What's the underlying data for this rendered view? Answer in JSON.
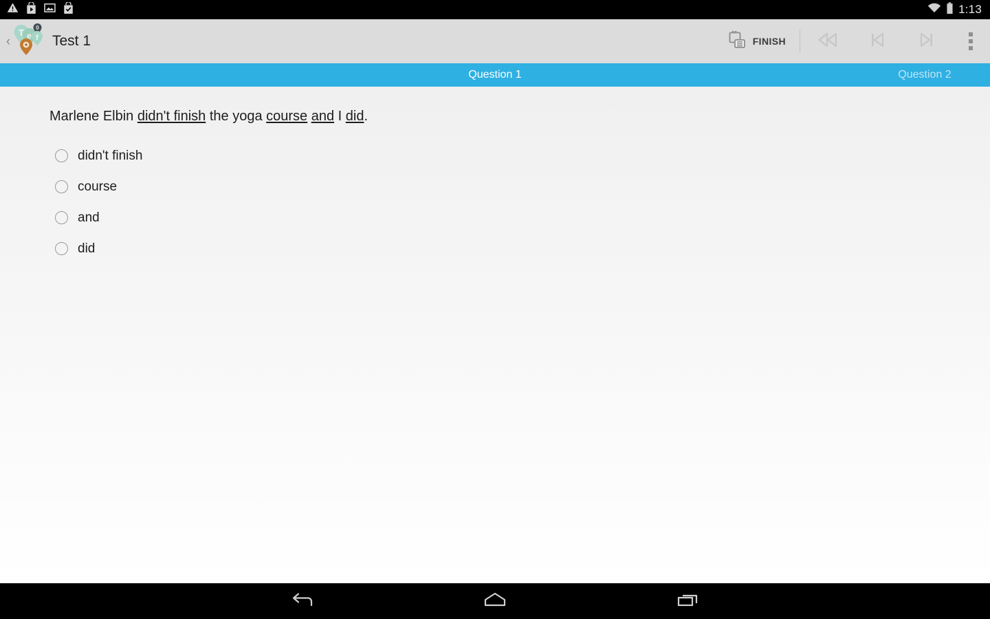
{
  "status_bar": {
    "time": "1:13",
    "left_icons": [
      "warning-triangle-icon",
      "play-store-bag-icon",
      "image-icon",
      "check-bag-icon"
    ],
    "right_icons": [
      "wifi-icon",
      "battery-icon"
    ],
    "background_color": "#000000"
  },
  "toolbar": {
    "back_chevron": "‹",
    "app_title": "Test 1",
    "logo_name": "teofo-pins-logo",
    "logo_letters": [
      "T",
      "e",
      "0",
      "f",
      "o"
    ],
    "logo_colors": {
      "teal": "#9fd2c8",
      "teal_light": "#a8d8ca",
      "orange": "#c97a2c",
      "dark": "#3f4a52"
    },
    "finish_label": "FINISH",
    "finish_icon": "clipboard-list-icon",
    "rewind_icon": "rewind-icon",
    "skip_previous_icon": "skip-previous-icon",
    "skip_next_icon": "skip-next-icon",
    "overflow_icon": "overflow-menu-icon",
    "background_color": "#dcdcdc"
  },
  "tabs": {
    "accent_color": "#2fb0e2",
    "active": {
      "label": "Question 1",
      "color": "#ffffff"
    },
    "next": {
      "label": "Question 2",
      "color": "#bfe6f7"
    }
  },
  "question": {
    "prefix": "Marlene Elbin ",
    "seg1": "didn't finish",
    "mid1": " the yoga ",
    "seg2": "course",
    "mid2": " ",
    "seg3": "and",
    "mid3": " I ",
    "seg4": "did",
    "suffix": "."
  },
  "options": [
    {
      "label": "didn't finish",
      "selected": false
    },
    {
      "label": "course",
      "selected": false
    },
    {
      "label": "and",
      "selected": false
    },
    {
      "label": "did",
      "selected": false
    }
  ],
  "nav_bar": {
    "back_icon": "back-arrow-icon",
    "home_icon": "home-icon",
    "recents_icon": "recents-icon",
    "background_color": "#000000"
  }
}
